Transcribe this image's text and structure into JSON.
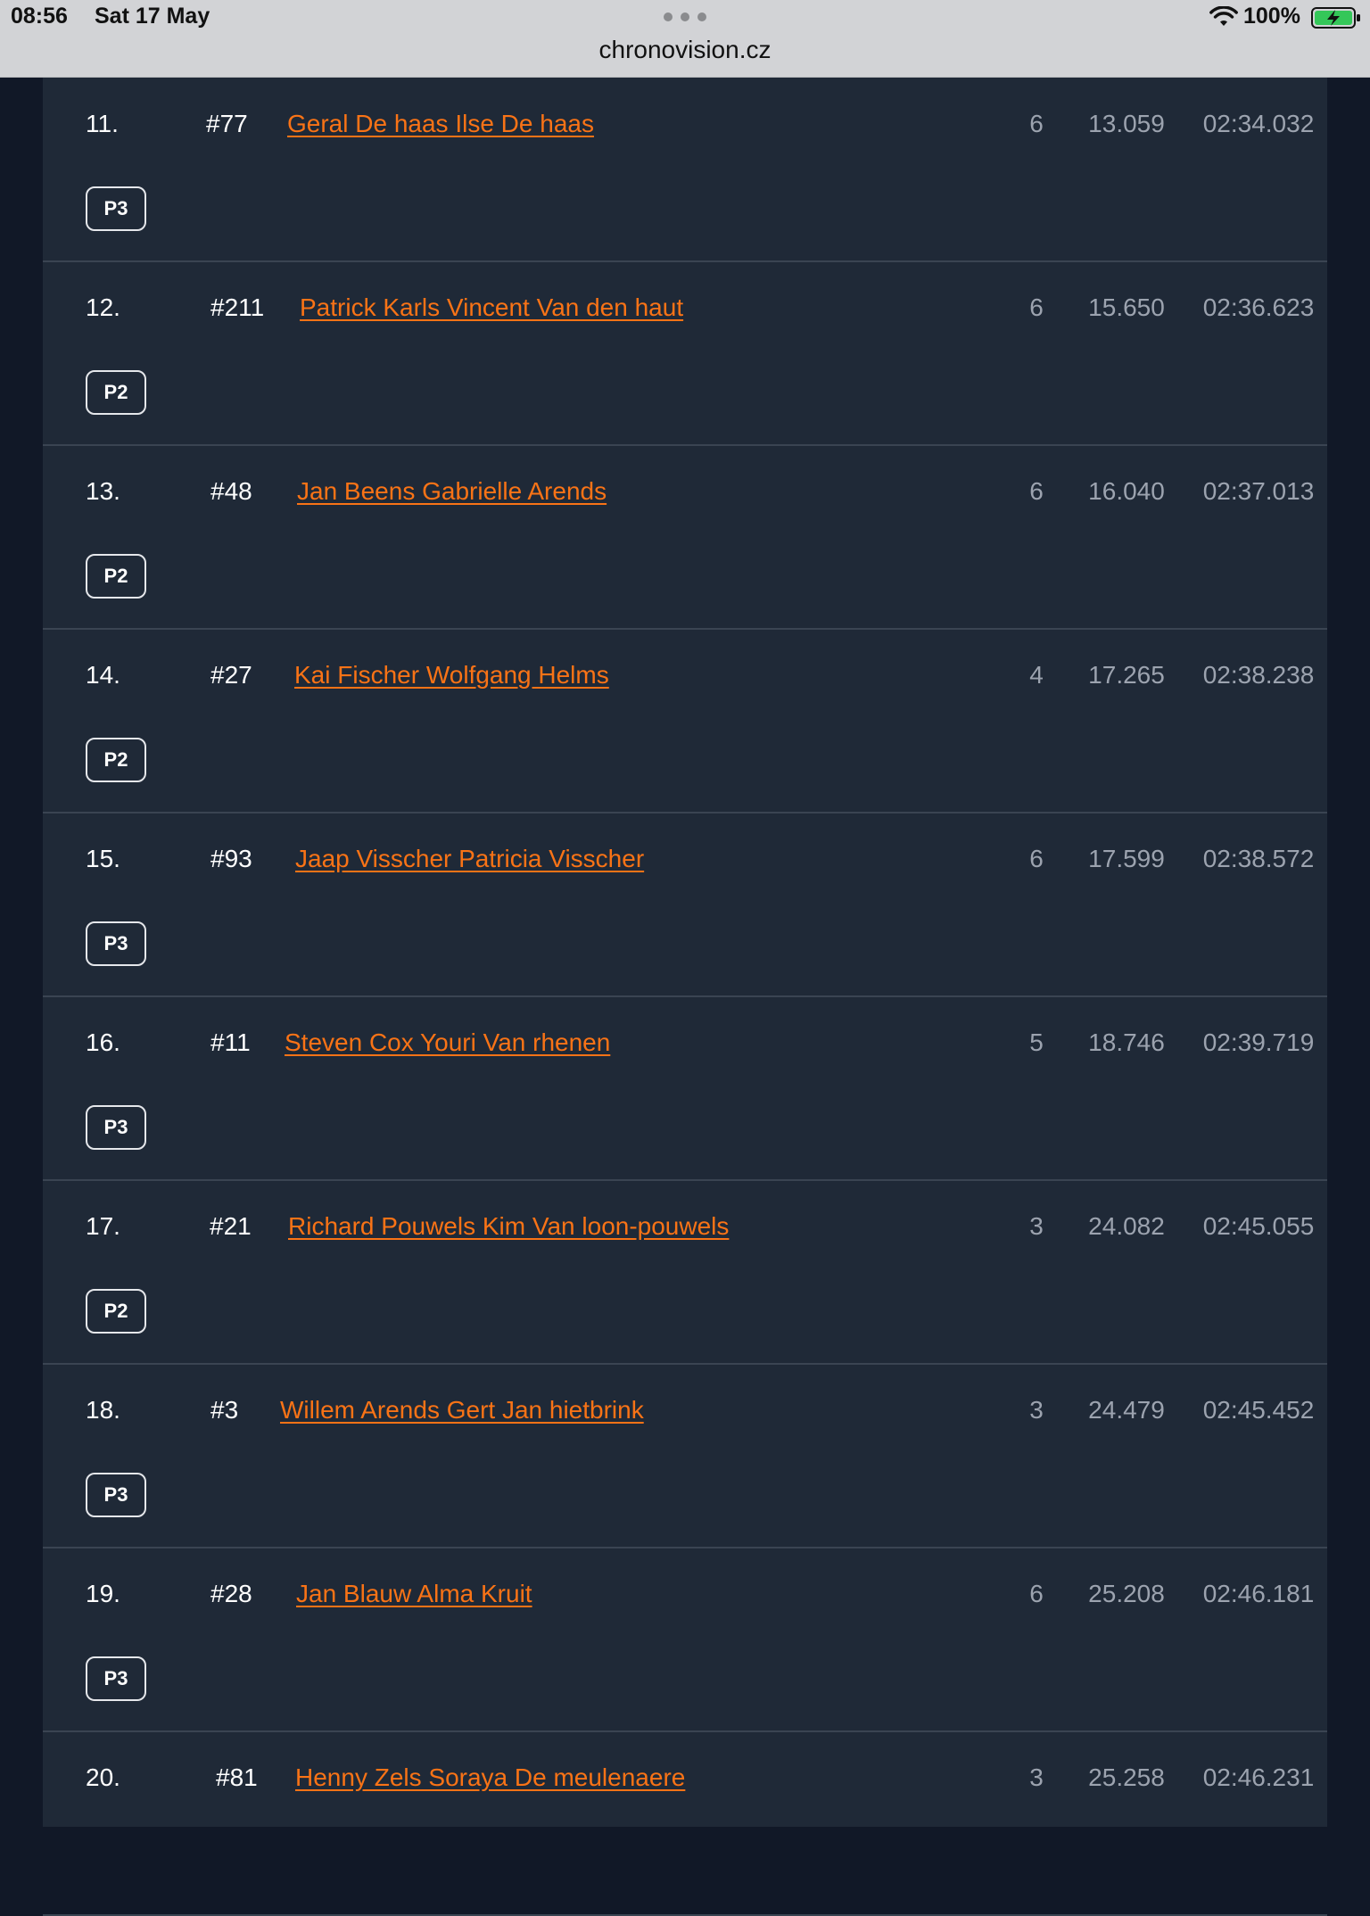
{
  "status_bar": {
    "time": "08:56",
    "date": "Sat 17 May",
    "battery": "100%"
  },
  "browser": {
    "url": "chronovision.cz"
  },
  "colors": {
    "accent_link": "#f97316",
    "panel_bg": "#1f2937",
    "page_bg": "#111827",
    "muted_text": "#9ca3af"
  },
  "rows": [
    {
      "pos": "11.",
      "num": "#77",
      "name": "Geral De haas Ilse De haas",
      "laps": "6",
      "gap": "13.059",
      "total": "02:34.032",
      "badge": "P3"
    },
    {
      "pos": "12.",
      "num": "#211",
      "name": "Patrick Karls Vincent Van den haut",
      "laps": "6",
      "gap": "15.650",
      "total": "02:36.623",
      "badge": "P2"
    },
    {
      "pos": "13.",
      "num": "#48",
      "name": "Jan Beens Gabrielle Arends",
      "laps": "6",
      "gap": "16.040",
      "total": "02:37.013",
      "badge": "P2"
    },
    {
      "pos": "14.",
      "num": "#27",
      "name": "Kai Fischer Wolfgang Helms",
      "laps": "4",
      "gap": "17.265",
      "total": "02:38.238",
      "badge": "P2"
    },
    {
      "pos": "15.",
      "num": "#93",
      "name": "Jaap Visscher Patricia Visscher",
      "laps": "6",
      "gap": "17.599",
      "total": "02:38.572",
      "badge": "P3"
    },
    {
      "pos": "16.",
      "num": "#11",
      "name": "Steven Cox Youri Van rhenen",
      "laps": "5",
      "gap": "18.746",
      "total": "02:39.719",
      "badge": "P3"
    },
    {
      "pos": "17.",
      "num": "#21",
      "name": "Richard Pouwels Kim Van loon-pouwels",
      "laps": "3",
      "gap": "24.082",
      "total": "02:45.055",
      "badge": "P2"
    },
    {
      "pos": "18.",
      "num": "#3",
      "name": "Willem Arends Gert Jan hietbrink",
      "laps": "3",
      "gap": "24.479",
      "total": "02:45.452",
      "badge": "P3"
    },
    {
      "pos": "19.",
      "num": "#28",
      "name": "Jan Blauw Alma Kruit",
      "laps": "6",
      "gap": "25.208",
      "total": "02:46.181",
      "badge": "P3"
    },
    {
      "pos": "20.",
      "num": "#81",
      "name": "Henny Zels Soraya De meulenaere",
      "laps": "3",
      "gap": "25.258",
      "total": "02:46.231",
      "badge": ""
    }
  ]
}
